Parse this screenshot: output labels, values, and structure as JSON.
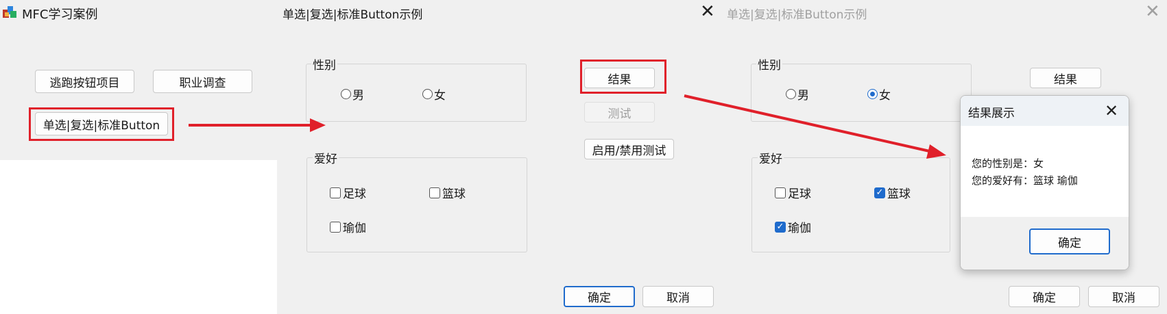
{
  "main_window": {
    "title": "MFC学习案例",
    "buttons": [
      "逃跑按钮项目",
      "职业调查",
      "单选|复选|标准Button"
    ]
  },
  "dialog_before": {
    "title": "单选|复选|标准Button示例",
    "gender_group": {
      "legend": "性别",
      "options": [
        "男",
        "女"
      ],
      "selected": ""
    },
    "hobby_group": {
      "legend": "爱好",
      "options": [
        "足球",
        "篮球",
        "瑜伽"
      ],
      "checked": []
    },
    "result_button": "结果",
    "test_button": "测试",
    "toggle_button": "启用/禁用测试",
    "ok_button": "确定",
    "cancel_button": "取消"
  },
  "dialog_after": {
    "title": "单选|复选|标准Button示例",
    "gender_group": {
      "legend": "性别",
      "options": [
        "男",
        "女"
      ],
      "selected": "女"
    },
    "hobby_group": {
      "legend": "爱好",
      "options": [
        "足球",
        "篮球",
        "瑜伽"
      ],
      "checked": [
        "篮球",
        "瑜伽"
      ]
    },
    "result_button": "结果",
    "ok_button": "确定",
    "cancel_button": "取消"
  },
  "result_dialog": {
    "title": "结果展示",
    "line1": "您的性别是：女",
    "line2": "您的爱好有：篮球 瑜伽",
    "ok_button": "确定"
  },
  "colors": {
    "annotation_red": "#e0202a",
    "accent_blue": "#1f6bcc",
    "dialog_bg": "#f0f0f0"
  },
  "icons": {
    "app": "mfc-app-icon",
    "close": "close-icon",
    "arrow": "red-arrow"
  }
}
